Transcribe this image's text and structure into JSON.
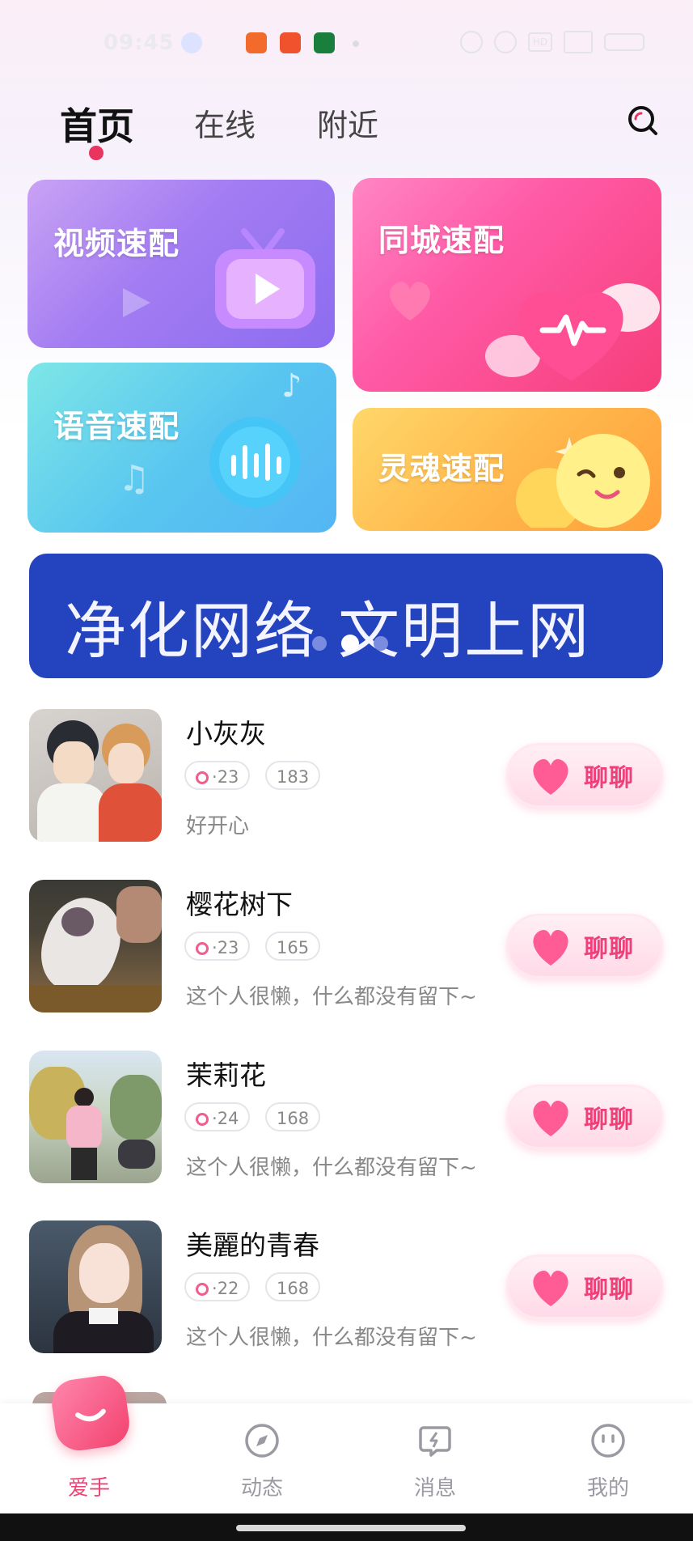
{
  "status_bar": {
    "time": "09:45",
    "hd": "HD"
  },
  "top_tabs": [
    {
      "label": "首页",
      "active": true
    },
    {
      "label": "在线",
      "active": false
    },
    {
      "label": "附近",
      "active": false
    }
  ],
  "match_cards": {
    "video": "视频速配",
    "city": "同城速配",
    "voice": "语音速配",
    "soul": "灵魂速配"
  },
  "banner": {
    "text": "净化网络 文明上网"
  },
  "users": [
    {
      "name": "小灰灰",
      "age": "23",
      "height": "183",
      "sign": "好开心"
    },
    {
      "name": "樱花树下",
      "age": "23",
      "height": "165",
      "sign": "这个人很懒，什么都没有留下~"
    },
    {
      "name": "茉莉花",
      "age": "24",
      "height": "168",
      "sign": "这个人很懒，什么都没有留下~"
    },
    {
      "name": "美麗的青春",
      "age": "22",
      "height": "168",
      "sign": "这个人很懒，什么都没有留下~"
    }
  ],
  "chat_label": "聊聊",
  "age_prefix": "·",
  "bottom_nav": [
    {
      "label": "爱手",
      "icon": "home-smile-icon",
      "active": true
    },
    {
      "label": "动态",
      "icon": "compass-icon",
      "active": false
    },
    {
      "label": "消息",
      "icon": "message-icon",
      "active": false
    },
    {
      "label": "我的",
      "icon": "profile-face-icon",
      "active": false
    }
  ],
  "colors": {
    "accent": "#e94676",
    "banner": "#2444bf"
  }
}
